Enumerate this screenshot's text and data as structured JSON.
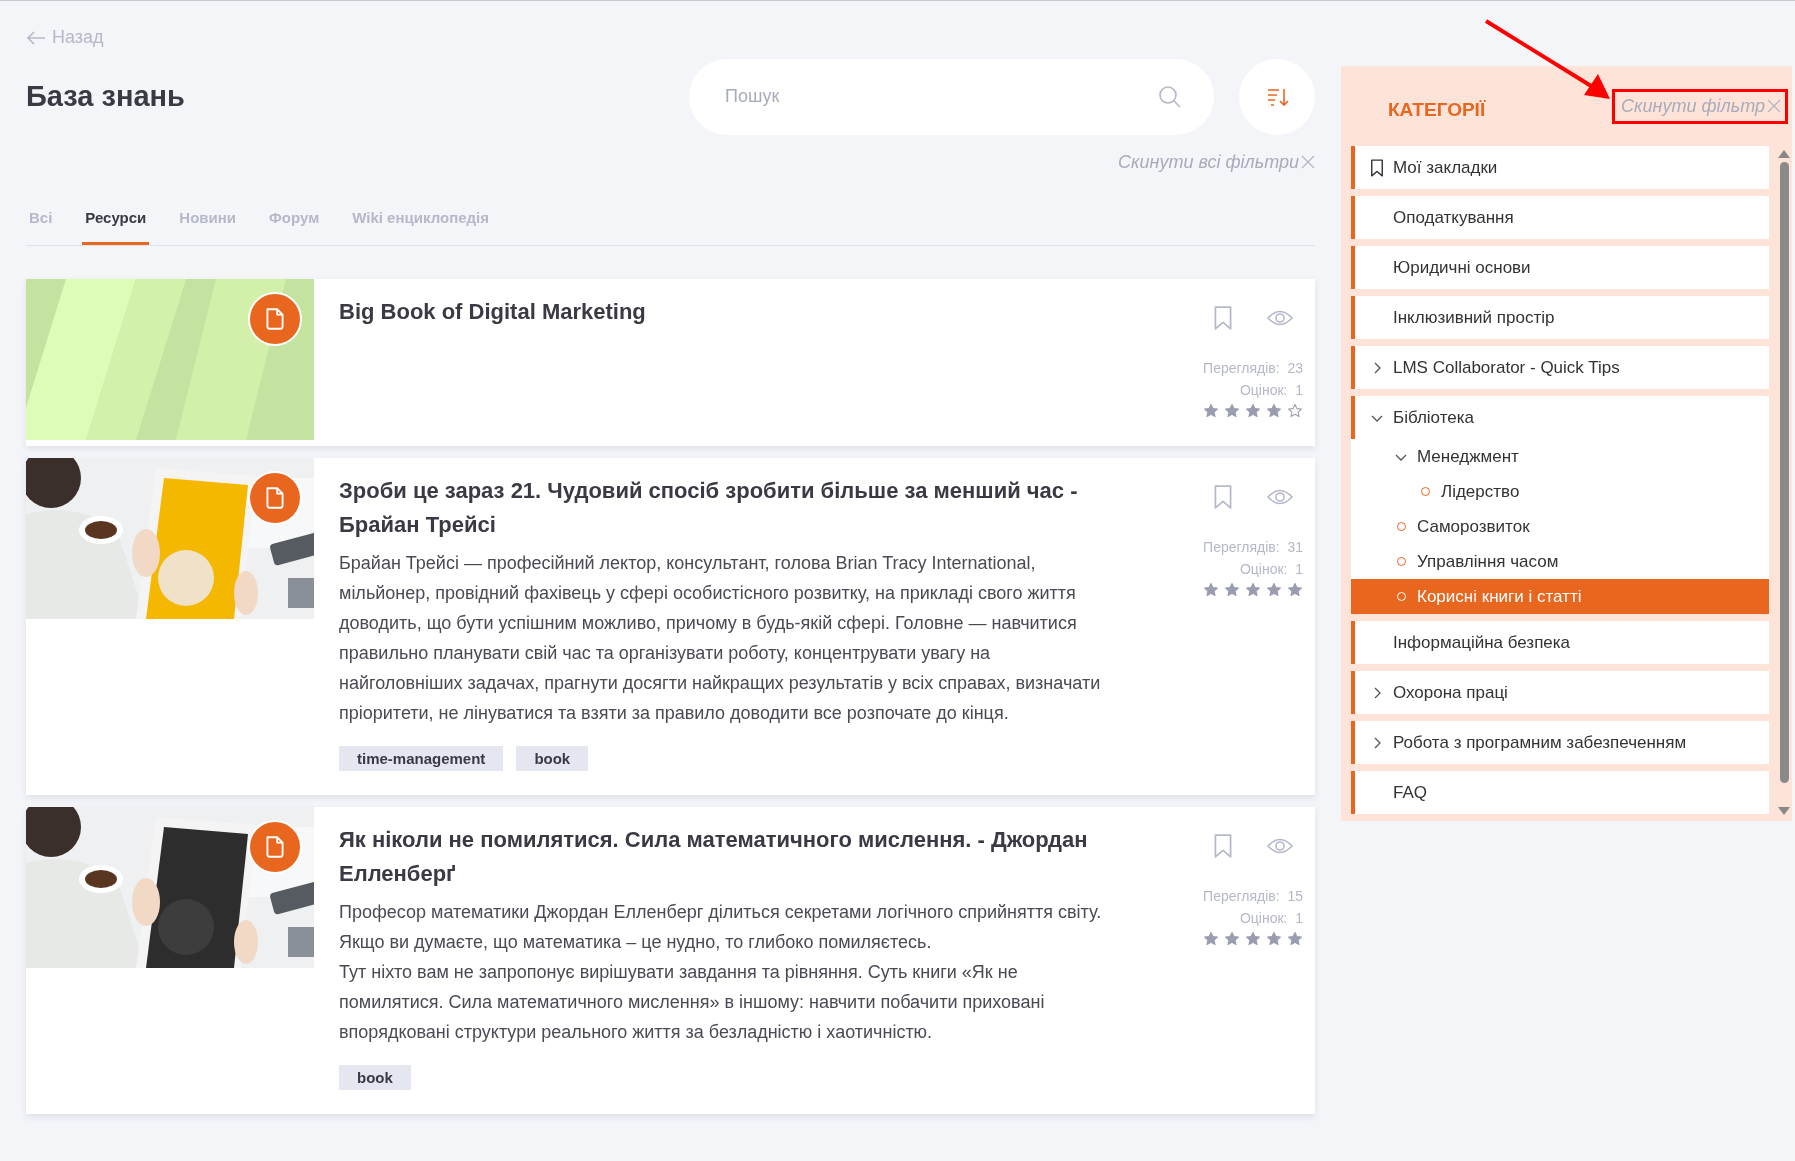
{
  "back_link": "Назад",
  "page_title": "База знань",
  "search": {
    "placeholder": "Пошук"
  },
  "reset_all_filters": "Скинути всі фільтри",
  "tabs": [
    {
      "label": "Всі",
      "selected": false
    },
    {
      "label": "Ресурси",
      "selected": true
    },
    {
      "label": "Новини",
      "selected": false
    },
    {
      "label": "Форум",
      "selected": false
    },
    {
      "label": "Wiki енциклопедія",
      "selected": false
    }
  ],
  "cards": [
    {
      "title": "Big Book of Digital Marketing",
      "views_label": "Переглядів:",
      "views": "23",
      "ratings_label": "Оцінок:",
      "ratings": "1",
      "stars": 4
    },
    {
      "title": "Зроби це зараз 21. Чудовий спосіб зробити більше за менший час - Брайан Трейсі",
      "description": "Брайан Трейсі — професійний лектор, консультант, голова Brian Tracy International, мільйонер, провідний фахівець у сфері особистісного розвитку, на прикладі свого життя доводить, що бути успішним можливо, причому в будь-якій сфері. Головне — навчитися правильно планувати свій час та організувати роботу, концентрувати увагу на найголовніших задачах, прагнути досягти найкращих результатів у всіх справах, визначати пріоритети, не лінуватися та взяти за правило доводити все розпочате до кінця.",
      "views_label": "Переглядів:",
      "views": "31",
      "ratings_label": "Оцінок:",
      "ratings": "1",
      "stars": 5,
      "tags": [
        "time-management",
        "book"
      ]
    },
    {
      "title": "Як ніколи не помилятися. Сила математичного мислення. - Джордан Елленберґ",
      "description": "Професор математики Джордан Елленберг ділиться секретами логічного сприйняття світу. Якщо ви думаєте, що математика – це нудно, то глибоко помиляєтесь.\nТут ніхто вам не запропонує вирішувати завдання та рівняння. Суть книги «Як не помилятися. Сила математичного мислення» в іншому: навчити побачити приховані впорядковані структури реального життя за безладністю і хаотичністю.",
      "views_label": "Переглядів:",
      "views": "15",
      "ratings_label": "Оцінок:",
      "ratings": "1",
      "stars": 5,
      "tags": [
        "book"
      ]
    }
  ],
  "categories": {
    "title": "КАТЕГОРІЇ",
    "reset": "Скинути фільтр",
    "items": [
      {
        "label": "Мої закладки",
        "kind": "bookmark",
        "selected": false
      },
      {
        "label": "Оподаткування",
        "kind": "folder",
        "selected": false
      },
      {
        "label": "Юридичні основи",
        "kind": "folder",
        "selected": false
      },
      {
        "label": "Інклюзивний простір",
        "kind": "folder",
        "selected": false
      },
      {
        "label": "LMS Collaborator - Quick Tips",
        "kind": "folder",
        "selected": false,
        "expanded": false
      },
      {
        "label": "Бібліотека",
        "kind": "folder",
        "selected": false,
        "expanded": true,
        "children": [
          {
            "label": "Менеджмент",
            "selected": false,
            "expanded": true,
            "children": [
              {
                "label": "Лідерство",
                "selected": false
              }
            ]
          },
          {
            "label": "Саморозвиток",
            "selected": false
          },
          {
            "label": "Управління часом",
            "selected": false
          },
          {
            "label": "Корисні книги і статті",
            "selected": true
          }
        ]
      },
      {
        "label": "Інформаційна безпека",
        "kind": "folder",
        "selected": false
      },
      {
        "label": "Охорона праці",
        "kind": "folder",
        "selected": false,
        "expanded": false
      },
      {
        "label": "Робота з програмним забезпеченням",
        "kind": "folder",
        "selected": false,
        "expanded": false
      },
      {
        "label": "FAQ",
        "kind": "folder",
        "selected": false
      }
    ]
  }
}
